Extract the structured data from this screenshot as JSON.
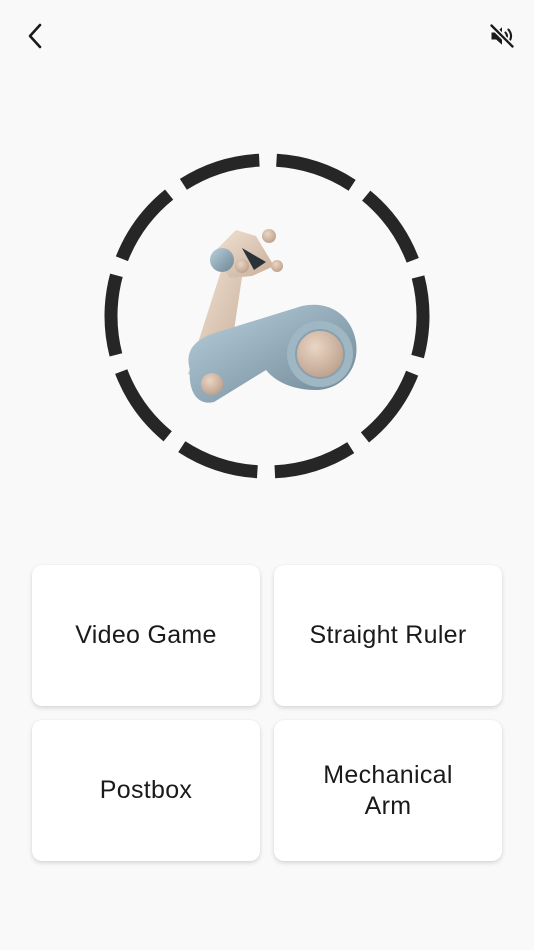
{
  "header": {
    "back_icon": "chevron-left-icon",
    "sound_icon": "speaker-muted-icon"
  },
  "question": {
    "image_icon": "mechanical-arm-icon"
  },
  "options": [
    {
      "label": "Video Game"
    },
    {
      "label": "Straight Ruler"
    },
    {
      "label": "Postbox"
    },
    {
      "label": "Mechanical Arm"
    }
  ],
  "colors": {
    "background": "#f9f9f9",
    "card": "#ffffff",
    "ring": "#262626",
    "text": "#1a1a1a"
  }
}
